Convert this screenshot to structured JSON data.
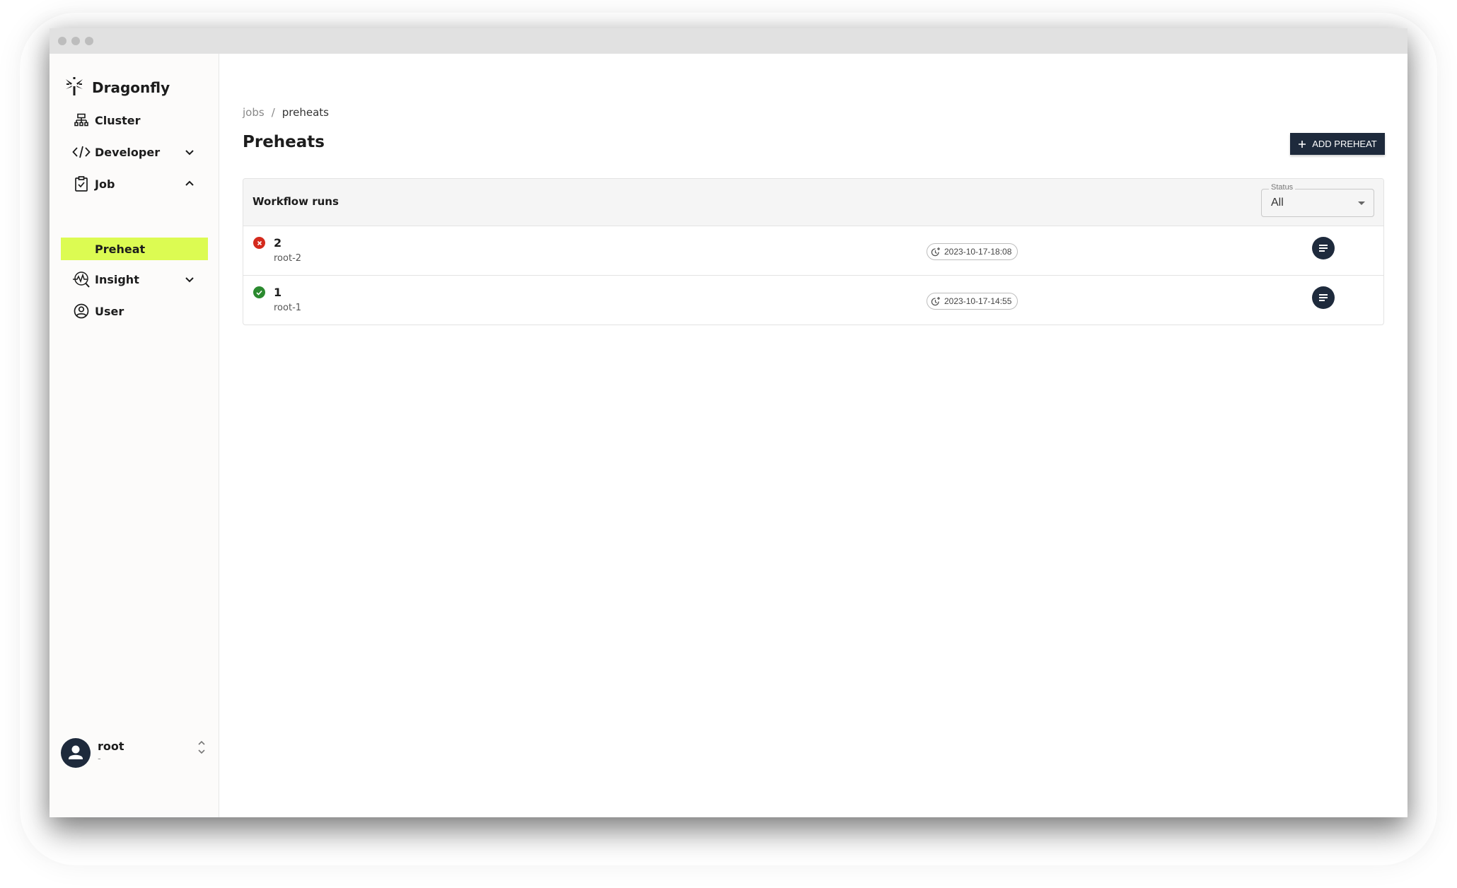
{
  "brand": {
    "name": "Dragonfly"
  },
  "sidebar": {
    "items": [
      {
        "label": "Cluster",
        "icon": "cluster-icon",
        "expandable": false
      },
      {
        "label": "Developer",
        "icon": "code-icon",
        "expandable": true,
        "expanded": false
      },
      {
        "label": "Job",
        "icon": "clipboard-check-icon",
        "expandable": true,
        "expanded": true
      },
      {
        "label": "Insight",
        "icon": "insight-icon",
        "expandable": true,
        "expanded": false
      },
      {
        "label": "User",
        "icon": "user-circle-icon",
        "expandable": false
      }
    ],
    "job_subitems": [
      {
        "label": "Preheat",
        "active": true
      }
    ],
    "user": {
      "name": "root",
      "subtitle": "-"
    }
  },
  "breadcrumb": {
    "items": [
      "jobs",
      "preheats"
    ],
    "separator": "/"
  },
  "page": {
    "title": "Preheats",
    "add_button_label": "ADD PREHEAT"
  },
  "table": {
    "title": "Workflow runs",
    "status_filter": {
      "label": "Status",
      "value": "All"
    },
    "rows": [
      {
        "id": "2",
        "user": "root-2",
        "status": "failed",
        "created_at": "2023-10-17-18:08"
      },
      {
        "id": "1",
        "user": "root-1",
        "status": "success",
        "created_at": "2023-10-17-14:55"
      }
    ]
  },
  "colors": {
    "accent": "#dcfb52",
    "primary": "#1e2a3c",
    "failed": "#d42a1d",
    "success": "#2b8a2f"
  }
}
